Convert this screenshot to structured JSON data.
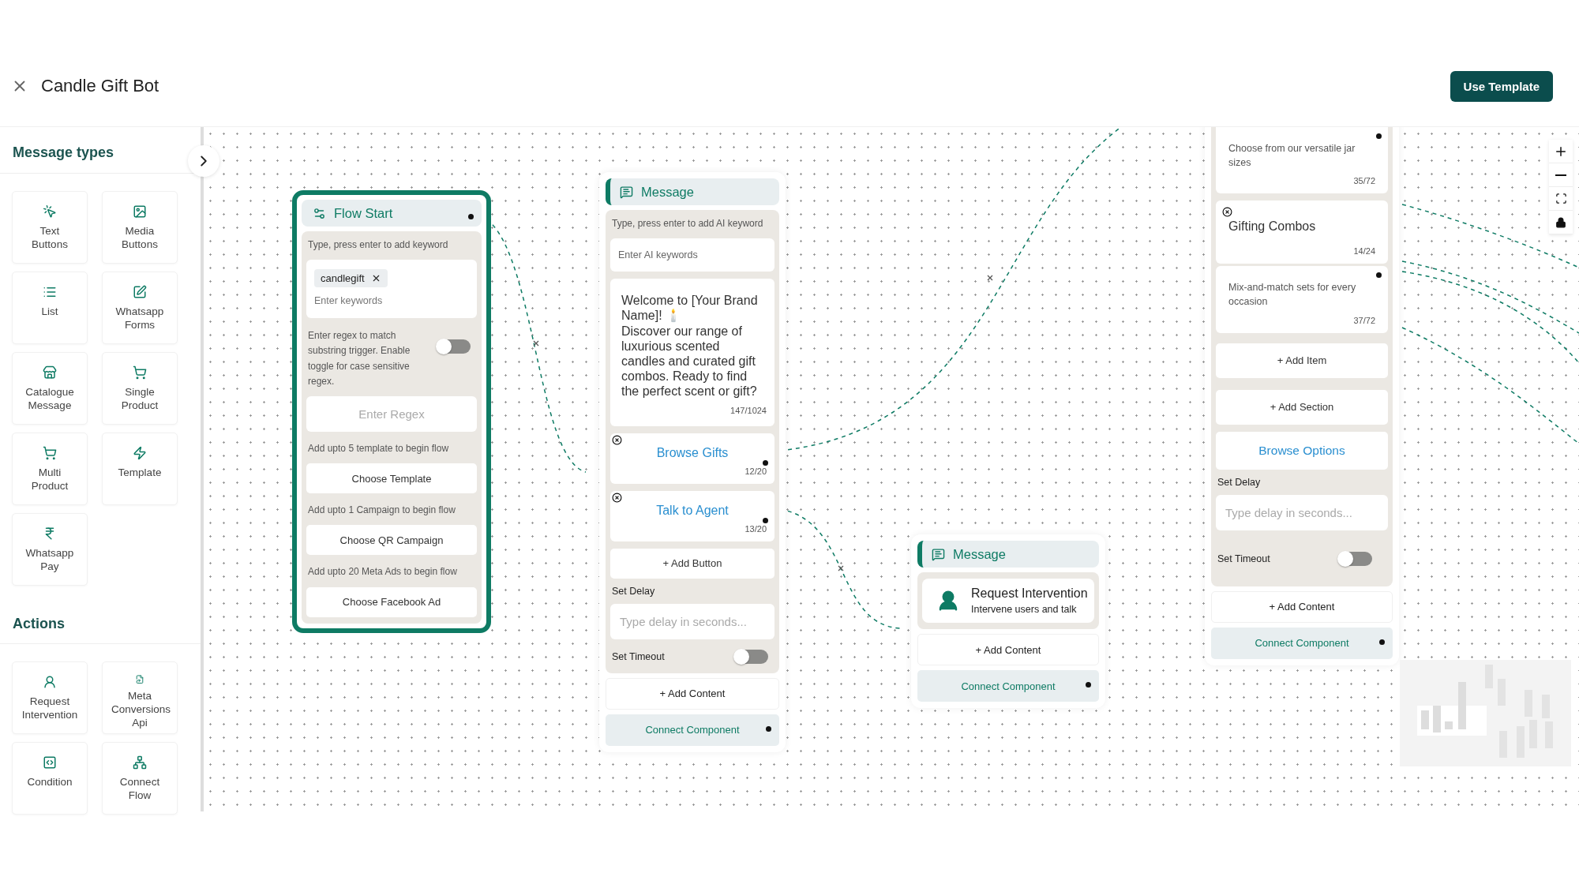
{
  "header": {
    "title": "Candle Gift Bot",
    "action_button": "Use Template"
  },
  "sidebar": {
    "sections": [
      {
        "title": "Message types",
        "items": [
          {
            "label": "Text Buttons"
          },
          {
            "label": "Media Buttons"
          },
          {
            "label": "List"
          },
          {
            "label": "Whatsapp Forms"
          },
          {
            "label": "Catalogue Message"
          },
          {
            "label": "Single Product"
          },
          {
            "label": "Multi Product"
          },
          {
            "label": "Template"
          },
          {
            "label": "Whatsapp Pay"
          }
        ]
      },
      {
        "title": "Actions",
        "items": [
          {
            "label": "Request Intervention"
          },
          {
            "label": "Meta Conversions Api"
          },
          {
            "label": "Condition"
          },
          {
            "label": "Connect Flow"
          }
        ]
      }
    ]
  },
  "flow_start": {
    "title": "Flow Start",
    "keyword_label": "Type, press enter to add keyword",
    "keywords": [
      "candlegift"
    ],
    "keyword_placeholder": "Enter keywords",
    "regex_label": "Enter regex to match substring trigger. Enable toggle for case sensitive regex.",
    "regex_toggle": {
      "on": false
    },
    "regex_placeholder": "Enter Regex",
    "triggers": [
      {
        "label": "Add upto 5 template to begin flow",
        "button": "Choose Template"
      },
      {
        "label": "Add upto 1 Campaign to begin flow",
        "button": "Choose QR Campaign"
      },
      {
        "label": "Add upto 20 Meta Ads to begin flow",
        "button": "Choose Facebook Ad"
      }
    ]
  },
  "message_node": {
    "title": "Message",
    "ai_label": "Type, press enter to add AI keyword",
    "ai_placeholder": "Enter AI keywords",
    "text": "Welcome to [Your Brand Name]! 🕯️\nDiscover our range of luxurious scented candles and curated gift combos. Ready to find the perfect scent or gift?",
    "text_counter": "147/1024",
    "buttons": [
      {
        "label": "Browse Gifts",
        "counter": "12/20"
      },
      {
        "label": "Talk to Agent",
        "counter": "13/20"
      }
    ],
    "add_button": "+ Add Button",
    "delay_label": "Set Delay",
    "delay_placeholder": "Type delay in seconds...",
    "timeout_label": "Set Timeout",
    "timeout": {
      "on": false
    },
    "add_content": "+ Add Content",
    "connect": "Connect Component"
  },
  "intervention_node": {
    "title": "Message",
    "card_title": "Request Intervention",
    "card_subtitle": "Intervene users and talk",
    "add_content": "+ Add Content",
    "connect": "Connect Component"
  },
  "list_node": {
    "items": [
      {
        "description": "Choose from our versatile jar sizes",
        "description_counter": "35/72"
      },
      {
        "title": "Gifting Combos",
        "title_counter": "14/24",
        "description": "Mix-and-match sets for every occasion",
        "description_counter": "37/72"
      }
    ],
    "add_item": "+ Add Item",
    "add_section": "+ Add Section",
    "button": "Browse Options",
    "delay_label": "Set Delay",
    "delay_placeholder": "Type delay in seconds...",
    "timeout_label": "Set Timeout",
    "timeout": {
      "on": false
    },
    "add_content": "+ Add Content",
    "connect": "Connect Component"
  }
}
